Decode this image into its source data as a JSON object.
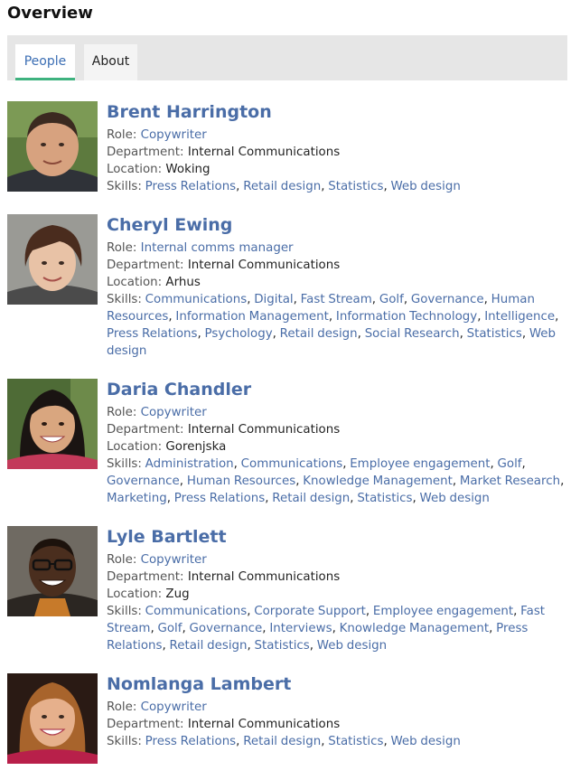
{
  "page_title": "Overview",
  "tabs": [
    {
      "label": "People",
      "active": true
    },
    {
      "label": "About",
      "active": false
    }
  ],
  "labels": {
    "role": "Role:",
    "department": "Department:",
    "location": "Location:",
    "skills": "Skills:",
    "separator": ", "
  },
  "colors": {
    "link": "#4a6da7",
    "tab_active_underline": "#3fb27f",
    "tab_bar_background": "#e6e6e6"
  },
  "people": [
    {
      "name": "Brent Harrington",
      "role": "Copywriter",
      "department": "Internal Communications",
      "location": "Woking",
      "skills": [
        "Press Relations",
        "Retail design",
        "Statistics",
        "Web design"
      ]
    },
    {
      "name": "Cheryl Ewing",
      "role": "Internal comms manager",
      "department": "Internal Communications",
      "location": "Arhus",
      "skills": [
        "Communications",
        "Digital",
        "Fast Stream",
        "Golf",
        "Governance",
        "Human Resources",
        "Information Management",
        "Information Technology",
        "Intelligence",
        "Press Relations",
        "Psychology",
        "Retail design",
        "Social Research",
        "Statistics",
        "Web design"
      ]
    },
    {
      "name": "Daria Chandler",
      "role": "Copywriter",
      "department": "Internal Communications",
      "location": "Gorenjska",
      "skills": [
        "Administration",
        "Communications",
        "Employee engagement",
        "Golf",
        "Governance",
        "Human Resources",
        "Knowledge Management",
        "Market Research",
        "Marketing",
        "Press Relations",
        "Retail design",
        "Statistics",
        "Web design"
      ]
    },
    {
      "name": "Lyle Bartlett",
      "role": "Copywriter",
      "department": "Internal Communications",
      "location": "Zug",
      "skills": [
        "Communications",
        "Corporate Support",
        "Employee engagement",
        "Fast Stream",
        "Golf",
        "Governance",
        "Interviews",
        "Knowledge Management",
        "Press Relations",
        "Retail design",
        "Statistics",
        "Web design"
      ]
    },
    {
      "name": "Nomlanga Lambert",
      "role": "Copywriter",
      "department": "Internal Communications",
      "skills": [
        "Press Relations",
        "Retail design",
        "Statistics",
        "Web design"
      ]
    }
  ]
}
